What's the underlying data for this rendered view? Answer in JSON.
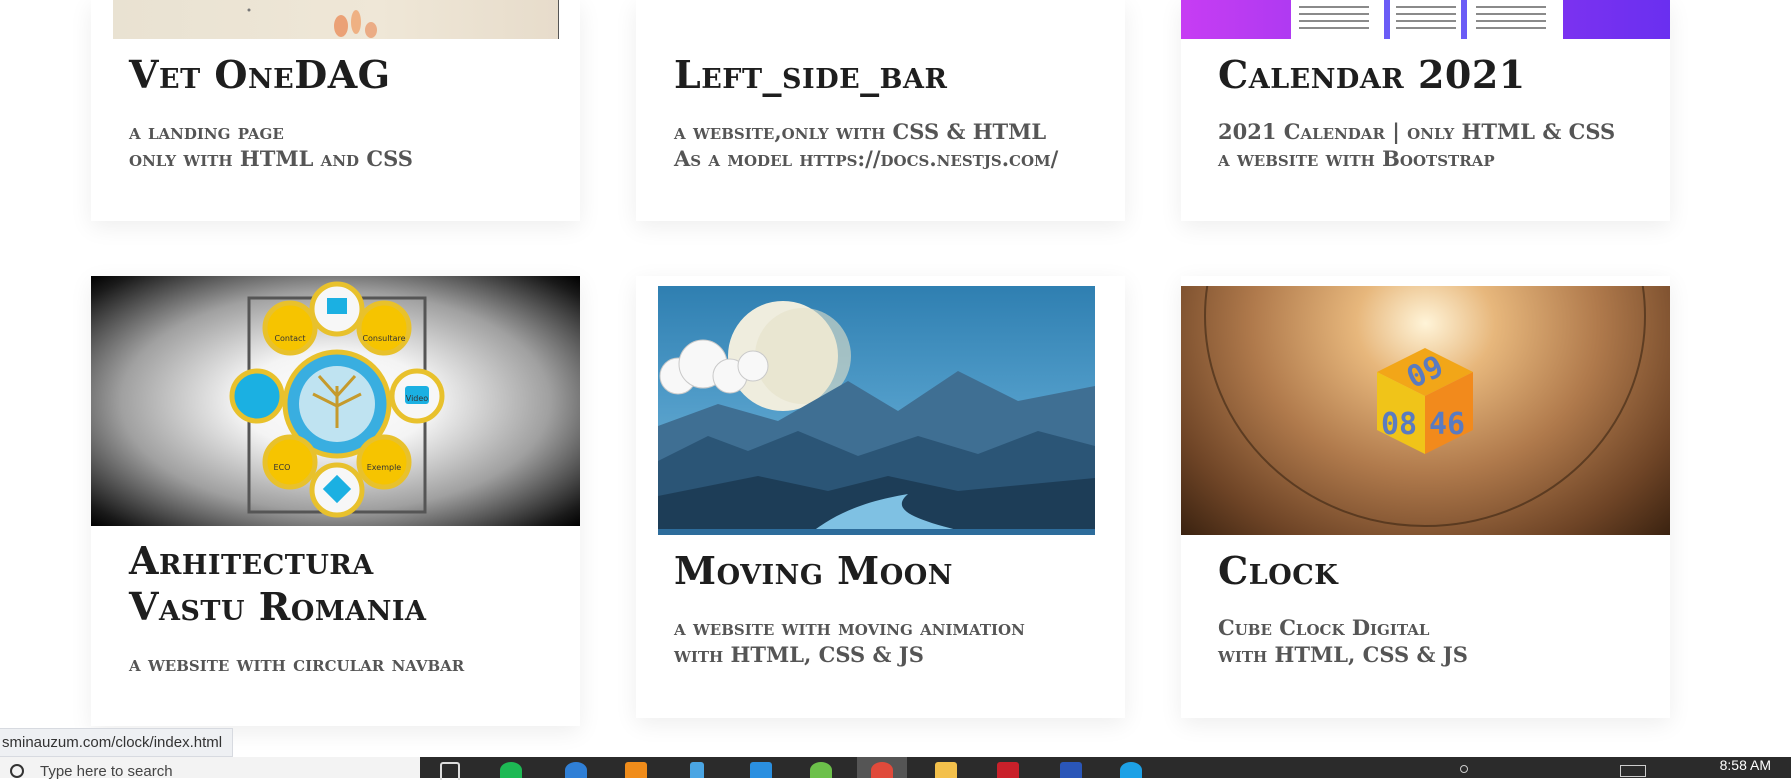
{
  "projects": [
    {
      "title": "Vet OneDAG",
      "desc_line1": "a landing page",
      "desc_line2": "only with HTML and CSS"
    },
    {
      "title": "Left_side_bar",
      "desc_line1": "a website,only with CSS & HTML",
      "desc_line2": "As a model https://docs.nestjs.com/"
    },
    {
      "title": "Calendar 2021",
      "desc_line1": "2021 Calendar | only HTML & CSS",
      "desc_line2": "a website with Bootstrap"
    },
    {
      "title_line1": "Arhitectura",
      "title_line2": "Vastu Romania",
      "desc_line1": "a website with circular navbar",
      "nav_labels": [
        "Contact",
        "Consultare",
        "Video",
        "Exemple",
        "ECO"
      ]
    },
    {
      "title": "Moving Moon",
      "desc_line1": "a website with moving animation",
      "desc_line2": "with HTML, CSS & JS"
    },
    {
      "title": "Clock",
      "desc_line1": "Cube Clock Digital",
      "desc_line2": "with HTML, CSS & JS",
      "cube_digits_top": "09",
      "cube_digits_left": "08",
      "cube_digits_right": "46"
    }
  ],
  "status_bar": {
    "url": "sminauzum.com/clock/index.html"
  },
  "taskbar": {
    "search_placeholder": "Type here to search",
    "time": "8:58 AM"
  }
}
